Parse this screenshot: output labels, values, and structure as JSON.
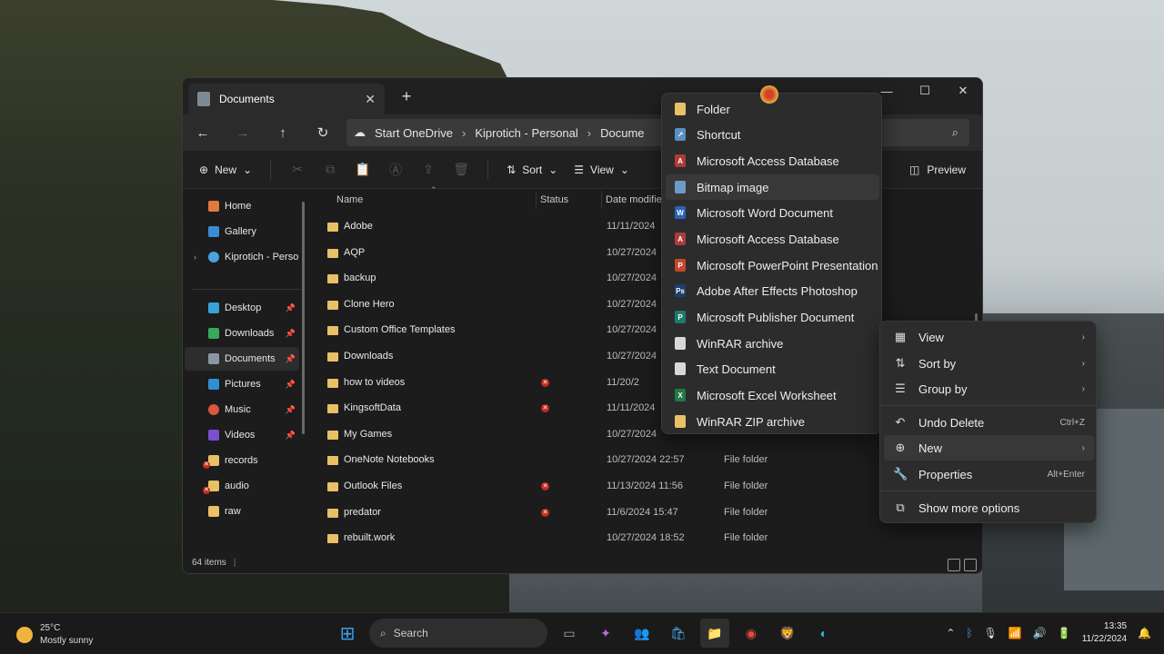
{
  "explorer": {
    "tab_title": "Documents",
    "tab_close": "✕",
    "new_tab": "+",
    "window_controls": [
      "—",
      "☐",
      "✕"
    ],
    "address": [
      "Start OneDrive",
      "Kiprotich - Personal",
      "Docume"
    ],
    "toolbar": {
      "new_label": "New",
      "sort_label": "Sort",
      "view_label": "View",
      "preview_label": "Preview"
    },
    "sidebar": {
      "items": [
        {
          "label": "Home",
          "icon": "home-icon",
          "color": "#e07a3f"
        },
        {
          "label": "Gallery",
          "icon": "gallery-icon",
          "color": "#3a8bd6"
        },
        {
          "label": "Kiprotich - Persor",
          "icon": "cloud-icon",
          "color": "#4aa3df"
        },
        {
          "label": "Desktop",
          "icon": "desktop-icon",
          "color": "#3aa1d8"
        },
        {
          "label": "Downloads",
          "icon": "download-icon",
          "color": "#39a85b"
        },
        {
          "label": "Documents",
          "icon": "documents-icon",
          "color": "#8a97a3"
        },
        {
          "label": "Pictures",
          "icon": "pictures-icon",
          "color": "#2f8fd0"
        },
        {
          "label": "Music",
          "icon": "music-icon",
          "color": "#d9573c"
        },
        {
          "label": "Videos",
          "icon": "videos-icon",
          "color": "#7b4fcf"
        },
        {
          "label": "records",
          "icon": "folder-icon",
          "color": "#e8c067"
        },
        {
          "label": "audio",
          "icon": "folder-icon",
          "color": "#e8c067"
        },
        {
          "label": "raw",
          "icon": "folder-icon",
          "color": "#e8c067"
        }
      ]
    },
    "columns": {
      "name": "Name",
      "status": "Status",
      "date": "Date modified"
    },
    "files": [
      {
        "name": "Adobe",
        "date": "11/11/2024",
        "type": "",
        "error": false
      },
      {
        "name": "AQP",
        "date": "10/27/2024",
        "type": "",
        "error": false
      },
      {
        "name": "backup",
        "date": "10/27/2024",
        "type": "",
        "error": false
      },
      {
        "name": "Clone Hero",
        "date": "10/27/2024",
        "type": "",
        "error": false
      },
      {
        "name": "Custom Office Templates",
        "date": "10/27/2024",
        "type": "",
        "error": false
      },
      {
        "name": "Downloads",
        "date": "10/27/2024",
        "type": "",
        "error": false
      },
      {
        "name": "how to videos",
        "date": "11/20/2",
        "type": "",
        "error": true
      },
      {
        "name": "KingsoftData",
        "date": "11/11/2024",
        "type": "",
        "error": true
      },
      {
        "name": "My Games",
        "date": "10/27/2024",
        "type": "",
        "error": false
      },
      {
        "name": "OneNote Notebooks",
        "date": "10/27/2024 22:57",
        "type": "File folder",
        "error": false
      },
      {
        "name": "Outlook Files",
        "date": "11/13/2024 11:56",
        "type": "File folder",
        "error": true
      },
      {
        "name": "predator",
        "date": "11/6/2024 15:47",
        "type": "File folder",
        "error": true
      },
      {
        "name": "rebuilt.work",
        "date": "10/27/2024 18:52",
        "type": "File folder",
        "error": false
      }
    ],
    "status_text": "64 items"
  },
  "new_menu": {
    "items": [
      {
        "label": "Folder",
        "icon": "folder-icon",
        "color": "#e8c067",
        "glyph": ""
      },
      {
        "label": "Shortcut",
        "icon": "shortcut-icon",
        "color": "#5a8fc4",
        "glyph": "↗"
      },
      {
        "label": "Microsoft Access Database",
        "icon": "access-icon",
        "color": "#b03a3a",
        "glyph": "A"
      },
      {
        "label": "Bitmap image",
        "icon": "bitmap-icon",
        "color": "#6c9bc9",
        "glyph": ""
      },
      {
        "label": "Microsoft Word Document",
        "icon": "word-icon",
        "color": "#2b62b8",
        "glyph": "W"
      },
      {
        "label": "Microsoft Access Database",
        "icon": "access-icon",
        "color": "#b03a3a",
        "glyph": "A"
      },
      {
        "label": "Microsoft PowerPoint Presentation",
        "icon": "powerpoint-icon",
        "color": "#c4472b",
        "glyph": "P"
      },
      {
        "label": "Adobe After Effects Photoshop",
        "icon": "photoshop-icon",
        "color": "#1c3f73",
        "glyph": "Ps"
      },
      {
        "label": "Microsoft Publisher Document",
        "icon": "publisher-icon",
        "color": "#1d7a6a",
        "glyph": "P"
      },
      {
        "label": "WinRAR archive",
        "icon": "winrar-icon",
        "color": "#d8d8d8",
        "glyph": ""
      },
      {
        "label": "Text Document",
        "icon": "text-document-icon",
        "color": "#d8d8d8",
        "glyph": ""
      },
      {
        "label": "Microsoft Excel Worksheet",
        "icon": "excel-icon",
        "color": "#1f7a46",
        "glyph": "X"
      },
      {
        "label": "WinRAR ZIP archive",
        "icon": "zip-icon",
        "color": "#e8c067",
        "glyph": ""
      }
    ]
  },
  "context_menu": {
    "items": [
      {
        "label": "View",
        "icon": "grid-icon",
        "glyph": "▦",
        "right": "›"
      },
      {
        "label": "Sort by",
        "icon": "sort-icon",
        "glyph": "⇅",
        "right": "›"
      },
      {
        "label": "Group by",
        "icon": "group-icon",
        "glyph": "☰",
        "right": "›"
      },
      {
        "label": "Undo Delete",
        "icon": "undo-icon",
        "glyph": "↶",
        "right": "Ctrl+Z"
      },
      {
        "label": "New",
        "icon": "new-icon",
        "glyph": "⊕",
        "right": "›"
      },
      {
        "label": "Properties",
        "icon": "wrench-icon",
        "glyph": "🔧",
        "right": "Alt+Enter"
      },
      {
        "label": "Show more options",
        "icon": "more-options-icon",
        "glyph": "⧉",
        "right": ""
      }
    ]
  },
  "taskbar": {
    "temperature": "25°C",
    "weather": "Mostly sunny",
    "search_placeholder": "Search",
    "time": "13:35",
    "date": "11/22/2024"
  }
}
